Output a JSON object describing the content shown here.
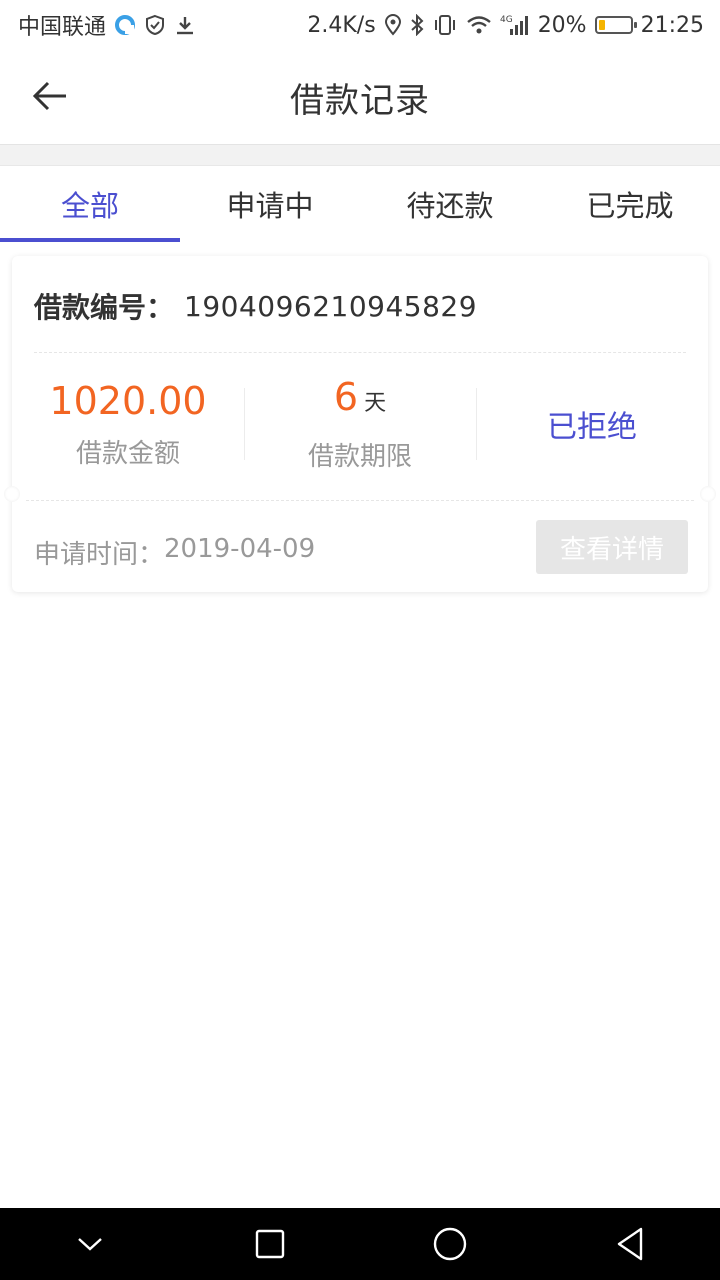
{
  "status_bar": {
    "carrier": "中国联通",
    "net_speed": "2.4K/s",
    "network_type": "4G",
    "battery_percent": "20%",
    "battery_level": 0.2,
    "time": "21:25"
  },
  "header": {
    "title": "借款记录"
  },
  "tabs": [
    {
      "label": "全部",
      "active": true
    },
    {
      "label": "申请中",
      "active": false
    },
    {
      "label": "待还款",
      "active": false
    },
    {
      "label": "已完成",
      "active": false
    }
  ],
  "loan": {
    "number_label": "借款编号：",
    "number": "1904096210945829",
    "amount": "1020.00",
    "amount_label": "借款金额",
    "term": "6",
    "term_unit": "天",
    "term_label": "借款期限",
    "status": "已拒绝",
    "apply_time_label": "申请时间：",
    "apply_time": "2019-04-09",
    "detail_button": "查看详情"
  },
  "colors": {
    "accent": "#4b4fd0",
    "amount": "#f26522",
    "muted": "#999999",
    "disabled_button": "#e6e6e6"
  }
}
